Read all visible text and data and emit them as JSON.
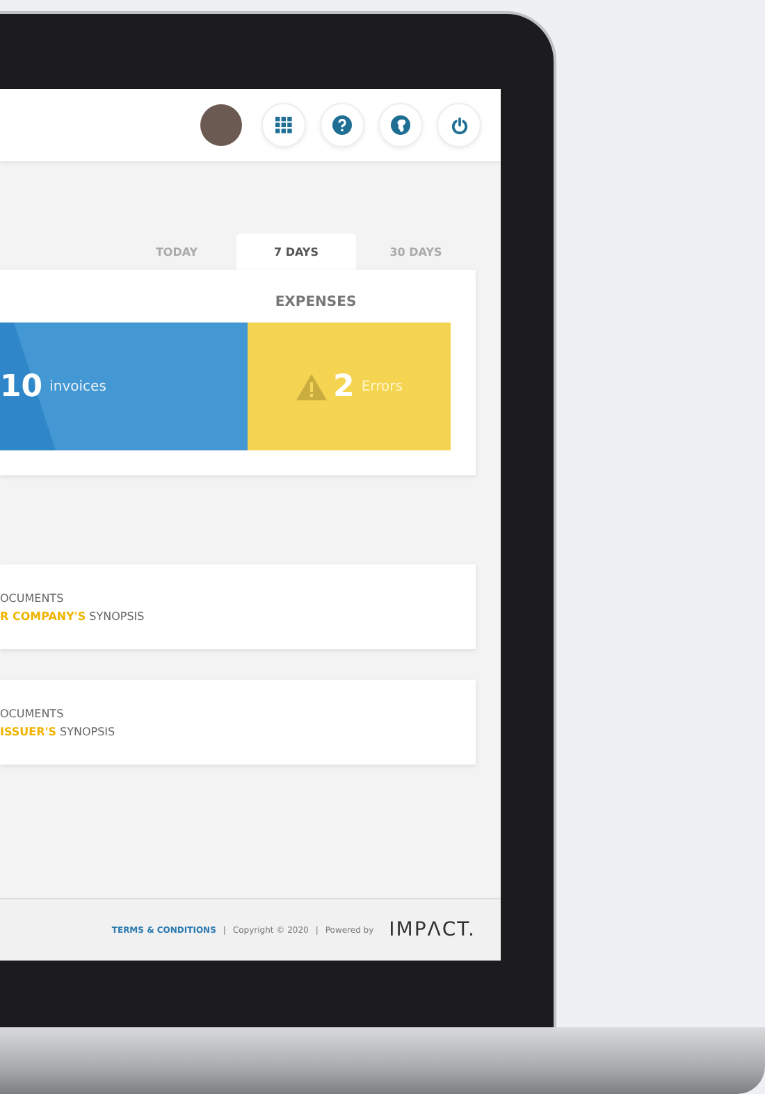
{
  "header": {
    "icons": [
      {
        "kind": "avatar"
      },
      {
        "kind": "apps"
      },
      {
        "kind": "help"
      },
      {
        "kind": "globe"
      },
      {
        "kind": "power"
      }
    ]
  },
  "tabs": [
    {
      "label": "TODAY",
      "selected": false
    },
    {
      "label": "7 DAYS",
      "selected": true
    },
    {
      "label": "30 DAYS",
      "selected": false
    }
  ],
  "expenses": {
    "title": "EXPENSES",
    "stats": [
      {
        "kind": "invoices",
        "value": "10",
        "label": "invoices"
      },
      {
        "kind": "errors",
        "value": "2",
        "label": "Errors"
      }
    ]
  },
  "documents": [
    {
      "title": "OCUMENTS",
      "subtitle": "**R COMPANY'S** SYNOPSIS"
    },
    {
      "title": "OCUMENTS",
      "subtitle": "**ISSUER'S** SYNOPSIS"
    }
  ],
  "footer": {
    "terms": "TERMS & CONDITIONS",
    "separator_1": "|",
    "copyright": "Copyright © 2020",
    "separator_2": "|",
    "powered": "Powered by",
    "logo": "IMPΛCT."
  }
}
